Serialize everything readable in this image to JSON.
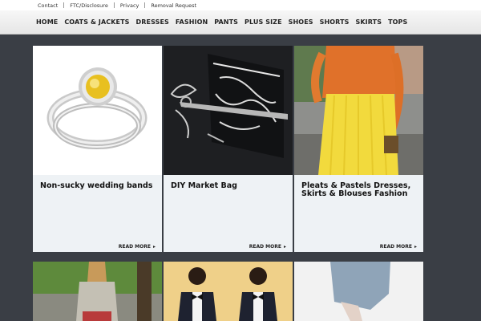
{
  "topbar": {
    "links": [
      "Contact",
      "FTC/Disclosure",
      "Privacy",
      "Removal Request"
    ]
  },
  "nav": {
    "items": [
      "HOME",
      "COATS & JACKETS",
      "DRESSES",
      "FASHION",
      "PANTS",
      "PLUS SIZE",
      "SHOES",
      "SHORTS",
      "SKIRTS",
      "TOPS"
    ]
  },
  "posts": [
    {
      "title": "Non-sucky wedding bands",
      "read_more": "READ MORE"
    },
    {
      "title": "DIY Market Bag",
      "read_more": "READ MORE"
    },
    {
      "title": "Pleats & Pastels Dresses, Skirts & Blouses Fashion",
      "read_more": "READ MORE"
    }
  ],
  "colors": {
    "background": "#3a3e45",
    "card": "#eef2f5",
    "nav_bg": "#eeeeee"
  }
}
